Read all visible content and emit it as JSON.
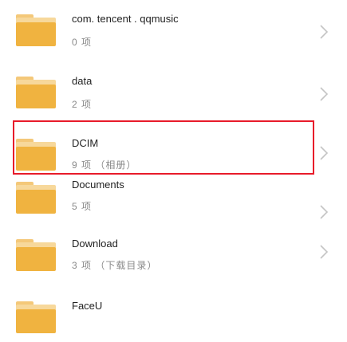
{
  "folders": [
    {
      "name": "com. tencent . qqmusic",
      "meta": "0 项"
    },
    {
      "name": "data",
      "meta": "2 项"
    },
    {
      "name": "DCIM",
      "meta": "9 项 （相册）"
    },
    {
      "name": "Documents",
      "meta": "5 项"
    },
    {
      "name": "Download",
      "meta": "3 项 （下载目录）"
    },
    {
      "name": "FaceU",
      "meta": ""
    }
  ],
  "icons": {
    "folder": "folder-icon",
    "chevron": "chevron-right-icon"
  },
  "colors": {
    "selection_border": "#e81b2a",
    "folder_front": "#f0b340",
    "folder_back": "#f7d89b"
  }
}
